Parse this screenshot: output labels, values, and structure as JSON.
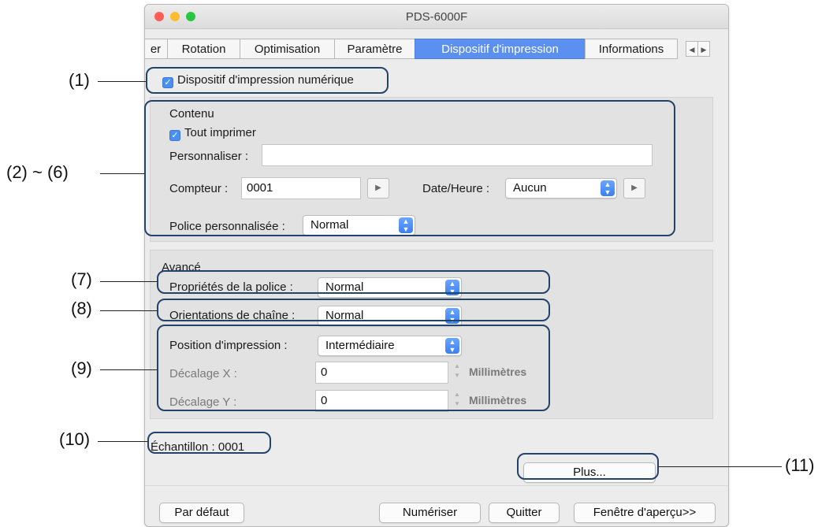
{
  "window": {
    "title": "PDS-6000F",
    "traffic_light_colors": [
      "#fd5f57",
      "#febc2e",
      "#27c840"
    ]
  },
  "tabs": {
    "items": [
      {
        "label": "er"
      },
      {
        "label": "Rotation"
      },
      {
        "label": "Optimisation"
      },
      {
        "label": "Paramètre"
      },
      {
        "label": "Dispositif d'impression",
        "active": true
      },
      {
        "label": "Informations"
      }
    ],
    "scroll_left": "◀",
    "scroll_right": "▶"
  },
  "digital_imprinter": {
    "label": "Dispositif d'impression numérique",
    "checked": true
  },
  "content": {
    "section_label": "Contenu",
    "print_all_label": "Tout imprimer",
    "print_all_checked": true,
    "customize_label": "Personnaliser :",
    "customize_value": "",
    "counter_label": "Compteur :",
    "counter_value": "0001",
    "datetime_label": "Date/Heure :",
    "datetime_value": "Aucun",
    "custom_font_label": "Police personnalisée :",
    "custom_font_value": "Normal"
  },
  "advanced": {
    "section_label": "Avancé",
    "font_properties_label": "Propriétés de la police :",
    "font_properties_value": "Normal",
    "string_orientation_label": "Orientations de chaîne :",
    "string_orientation_value": "Normal",
    "print_position_label": "Position d'impression :",
    "print_position_value": "Intermédiaire",
    "offset_x_label": "Décalage X :",
    "offset_x_value": "0",
    "offset_y_label": "Décalage Y :",
    "offset_y_value": "0",
    "unit": "Millimètres"
  },
  "sample": {
    "text": "Échantillon : 0001"
  },
  "buttons": {
    "more": "Plus...",
    "default": "Par défaut",
    "scan": "Numériser",
    "quit": "Quitter",
    "preview": "Fenêtre d'aperçu>>"
  },
  "callouts": {
    "c1": "(1)",
    "c2_6": "(2) ~ (6)",
    "c7": "(7)",
    "c8": "(8)",
    "c9": "(9)",
    "c10": "(10)",
    "c11": "(11)",
    "color": "#23436b"
  }
}
